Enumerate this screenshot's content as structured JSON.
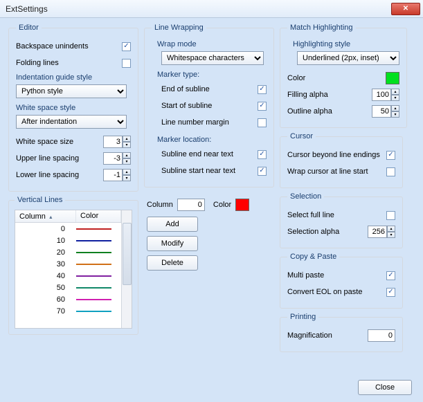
{
  "window": {
    "title": "ExtSettings",
    "close": "✕"
  },
  "editor": {
    "legend": "Editor",
    "backspace": "Backspace unindents",
    "folding": "Folding lines",
    "indent_guide_label": "Indentation guide style",
    "indent_guide_value": "Python style",
    "whitespace_style_label": "White space style",
    "whitespace_style_value": "After indentation",
    "ws_size_label": "White space size",
    "ws_size": "3",
    "upper_label": "Upper line spacing",
    "upper": "-3",
    "lower_label": "Lower line spacing",
    "lower": "-1"
  },
  "wrap": {
    "legend": "Line Wrapping",
    "mode_label": "Wrap mode",
    "mode_value": "Whitespace characters",
    "marker_type": "Marker type:",
    "end_subline": "End of subline",
    "start_subline": "Start of subline",
    "line_num_margin": "Line number margin",
    "marker_loc": "Marker location:",
    "end_near": "Subline end near text",
    "start_near": "Subline start near text"
  },
  "match": {
    "legend": "Match Highlighting",
    "style_label": "Highlighting style",
    "style_value": "Underlined (2px, inset)",
    "color_label": "Color",
    "color": "#00e020",
    "fill_label": "Filling alpha",
    "fill": "100",
    "outline_label": "Outline alpha",
    "outline": "50"
  },
  "cursor": {
    "legend": "Cursor",
    "beyond": "Cursor beyond line endings",
    "wrap": "Wrap cursor at line start"
  },
  "selection": {
    "legend": "Selection",
    "full": "Select full line",
    "alpha_label": "Selection alpha",
    "alpha": "256"
  },
  "copy": {
    "legend": "Copy & Paste",
    "multi": "Multi paste",
    "eol": "Convert EOL on paste"
  },
  "printing": {
    "legend": "Printing",
    "mag_label": "Magnification",
    "mag": "0"
  },
  "vlines": {
    "legend": "Vertical Lines",
    "col_head": "Column",
    "color_head": "Color",
    "column_label": "Column",
    "column_val": "0",
    "color_label": "Color",
    "color_val": "#ff0000",
    "add": "Add",
    "modify": "Modify",
    "delete": "Delete",
    "rows": [
      {
        "col": "0",
        "color": "#c02020"
      },
      {
        "col": "10",
        "color": "#1020a0"
      },
      {
        "col": "20",
        "color": "#108020"
      },
      {
        "col": "30",
        "color": "#d07018"
      },
      {
        "col": "40",
        "color": "#8020a0"
      },
      {
        "col": "50",
        "color": "#108868"
      },
      {
        "col": "60",
        "color": "#d020b0"
      },
      {
        "col": "70",
        "color": "#10a0c0"
      }
    ]
  },
  "footer": {
    "close": "Close"
  }
}
